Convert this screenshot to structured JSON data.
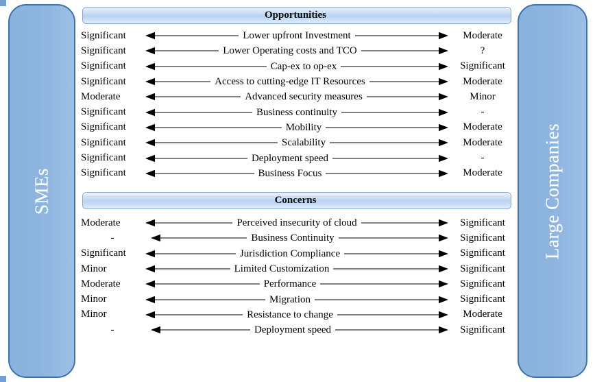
{
  "panels": {
    "left": {
      "label": "SMEs",
      "fill": "#8cb4df",
      "border": "#3f72ab",
      "text_color": "#ffffff"
    },
    "right": {
      "label": "Large Companies",
      "fill": "#8cb4df",
      "border": "#3f72ab",
      "text_color": "#ffffff"
    }
  },
  "sections": [
    {
      "id": "opportunities",
      "title": "Opportunities",
      "rows": [
        {
          "left": "Significant",
          "middle": "Lower upfront Investment",
          "right": "Moderate"
        },
        {
          "left": "Significant",
          "middle": "Lower Operating costs and TCO",
          "right": "?"
        },
        {
          "left": "Significant",
          "middle": "Cap-ex to op-ex",
          "right": "Significant"
        },
        {
          "left": "Significant",
          "middle": "Access to  cutting-edge IT Resources",
          "right": "Moderate"
        },
        {
          "left": "Moderate",
          "middle": "Advanced security measures",
          "right": "Minor"
        },
        {
          "left": "Significant",
          "middle": "Business continuity",
          "right": "-"
        },
        {
          "left": "Significant",
          "middle": "Mobility",
          "right": "Moderate"
        },
        {
          "left": "Significant",
          "middle": "Scalability",
          "right": "Moderate"
        },
        {
          "left": "Significant",
          "middle": "Deployment speed",
          "right": "-"
        },
        {
          "left": "Significant",
          "middle": "Business Focus",
          "right": "Moderate"
        }
      ]
    },
    {
      "id": "concerns",
      "title": "Concerns",
      "rows": [
        {
          "left": "Moderate",
          "middle": "Perceived insecurity of cloud",
          "right": "Significant"
        },
        {
          "left": "-",
          "middle": "Business Continuity",
          "right": "Significant"
        },
        {
          "left": "Significant",
          "middle": "Jurisdiction Compliance",
          "right": "Significant"
        },
        {
          "left": "Minor",
          "middle": "Limited Customization",
          "right": "Significant"
        },
        {
          "left": "Moderate",
          "middle": "Performance",
          "right": "Significant"
        },
        {
          "left": "Minor",
          "middle": "Migration",
          "right": "Significant"
        },
        {
          "left": "Minor",
          "middle": "Resistance to change",
          "right": "Moderate"
        },
        {
          "left": "-",
          "middle": "Deployment speed",
          "right": "Significant"
        }
      ]
    }
  ]
}
